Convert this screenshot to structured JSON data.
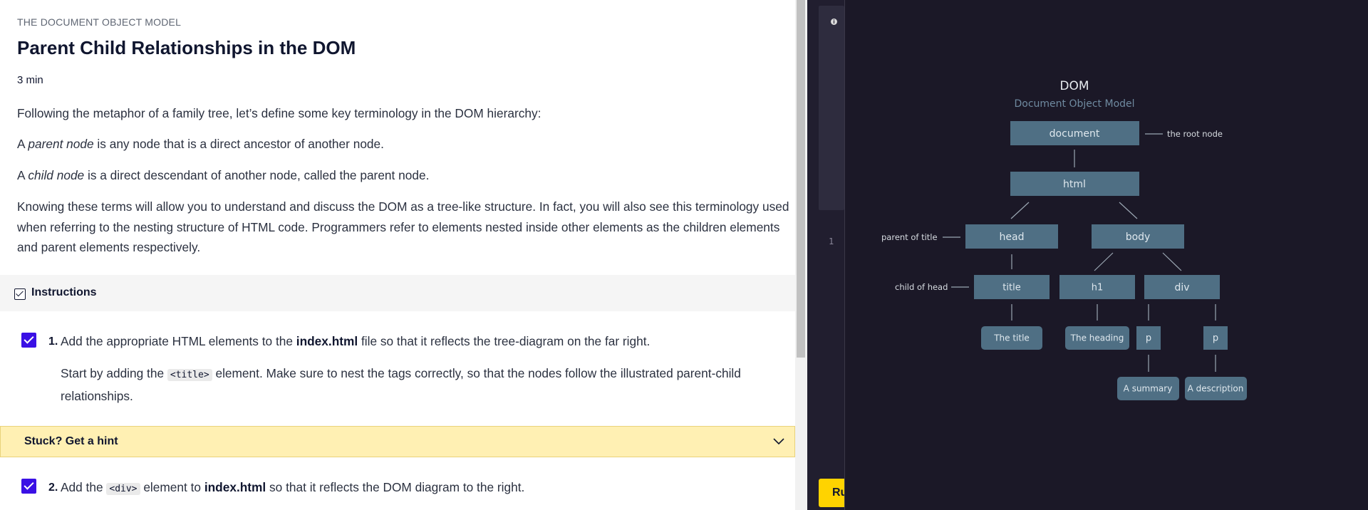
{
  "lesson": {
    "overline": "THE DOCUMENT OBJECT MODEL",
    "title": "Parent Child Relationships in the DOM",
    "duration": "3 min",
    "intro": "Following the metaphor of a family tree, let’s define some key terminology in the DOM hierarchy:",
    "parent_def": {
      "prefix": "A ",
      "term": "parent node",
      "suffix": " is any node that is a direct ancestor of another node."
    },
    "child_def": {
      "prefix": "A ",
      "term": "child node",
      "suffix": " is a direct descendant of another node, called the parent node."
    },
    "knowing": "Knowing these terms will allow you to understand and discuss the DOM as a tree-like structure. In fact, you will also see this terminology used when referring to the nesting structure of HTML code. Programmers refer to elements nested inside other elements as the children elements and parent elements respectively."
  },
  "instructions": {
    "label": "Instructions",
    "tasks": [
      {
        "num": "1.",
        "checked": true,
        "text_a": "Add the appropriate HTML elements to the ",
        "file": "index.html",
        "text_b": " file so that it reflects the tree-diagram on the far right.",
        "detail_a": "Start by adding the ",
        "code": "<title>",
        "detail_b": " element. Make sure to nest the tags correctly, so that the nodes follow the illustrated parent-child relationships."
      },
      {
        "num": "2.",
        "checked": true,
        "text_a": "Add the ",
        "code": "<div>",
        "text_b": " element to ",
        "file": "index.html",
        "text_c": " so that it reflects the DOM diagram to the right."
      }
    ]
  },
  "hint": {
    "label": "Stuck? Get a hint"
  },
  "editor": {
    "line_number": "1",
    "info_icon": "info-icon",
    "run_label": "Run"
  },
  "diagram": {
    "heading": "DOM",
    "subheading": "Document Object Model",
    "nodes": {
      "document": "document",
      "html": "html",
      "head": "head",
      "body": "body",
      "title": "title",
      "h1": "h1",
      "div": "div",
      "title_text": "The title",
      "heading_text": "The heading",
      "p1": "p",
      "p2": "p",
      "summary": "A summary",
      "description": "A description"
    },
    "annotations": {
      "root": "the root node",
      "parent_of_title": "parent of title",
      "child_of_head": "child of head"
    }
  },
  "colors": {
    "task_check": "#3a10e5",
    "hint_bg": "#fff0b3",
    "run_button": "#ffd300",
    "diagram_bg": "#1b1827",
    "node_fill": "#4f6f84"
  }
}
